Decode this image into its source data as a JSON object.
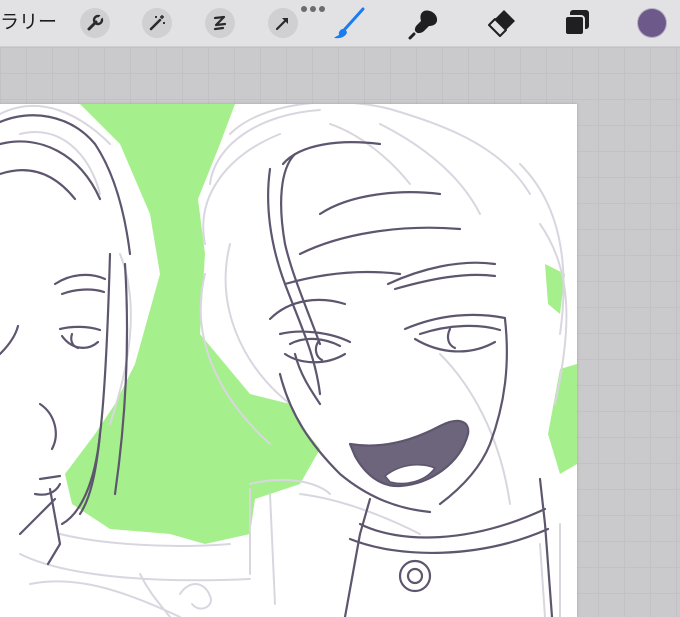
{
  "toolbar": {
    "gallery_label": "ラリー",
    "actions_icon": "wrench-icon",
    "adjustments_icon": "magic-wand-icon",
    "selection_icon": "s-curve-icon",
    "transform_icon": "arrow-icon",
    "brush_icon": "brush-icon",
    "smudge_icon": "smudge-icon",
    "eraser_icon": "eraser-icon",
    "layers_icon": "layers-icon",
    "active_tool": "brush",
    "active_color": "#6e5a8a",
    "accent_color": "#1a7cf2"
  },
  "canvas": {
    "background_color": "#ffffff",
    "fill_color": "#a5f08c",
    "sketch_color": "#d9d6e0",
    "lineart_color": "#5e566e"
  }
}
